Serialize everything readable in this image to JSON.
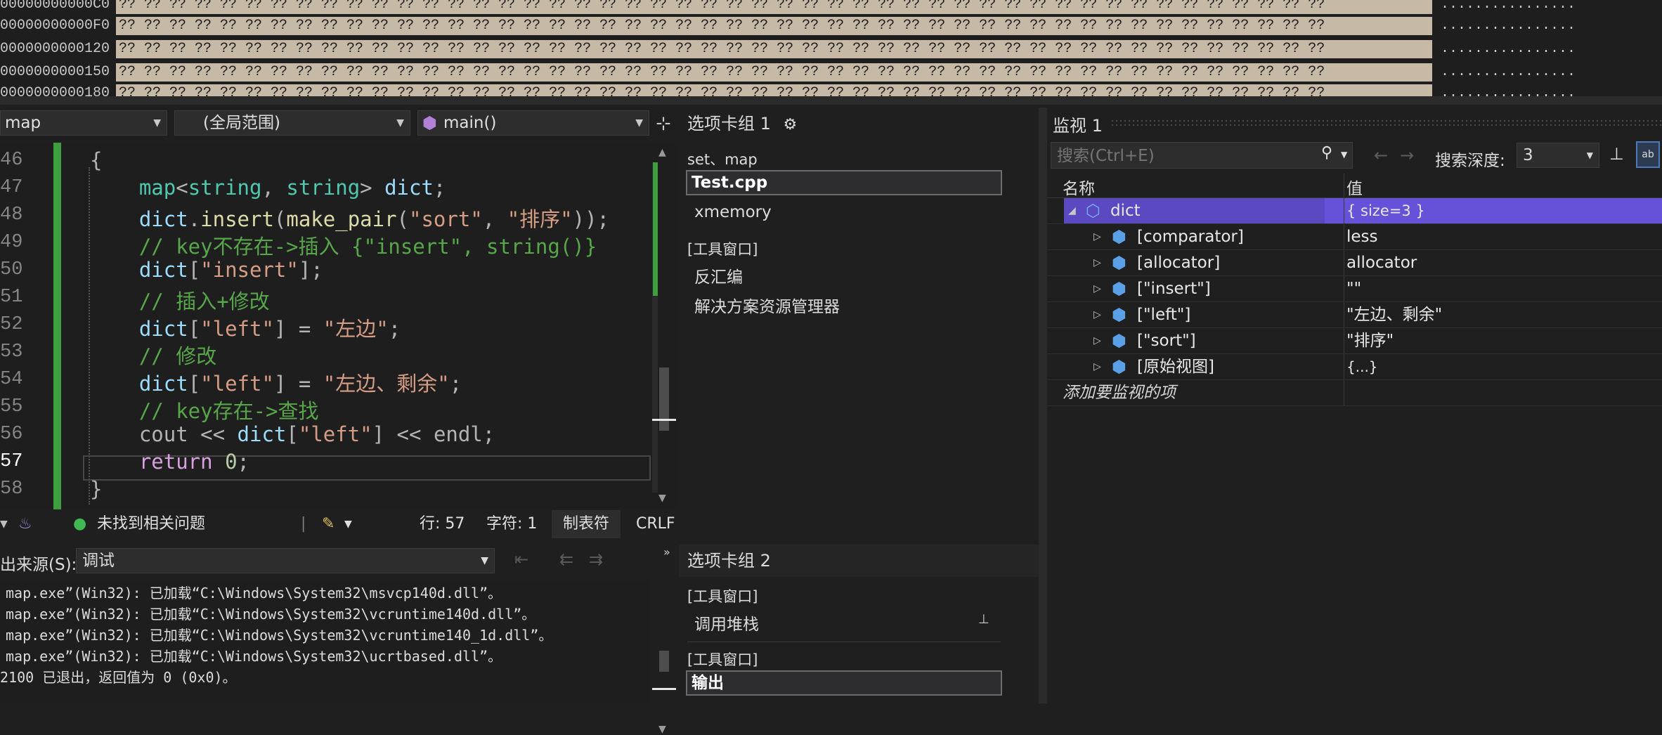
{
  "memory": {
    "rows": [
      {
        "address": "00000000000C0",
        "bytes": "?? ?? ?? ?? ?? ?? ?? ?? ?? ?? ?? ?? ?? ?? ?? ?? ?? ?? ?? ?? ?? ?? ?? ?? ?? ?? ?? ?? ?? ?? ?? ?? ?? ?? ?? ?? ?? ?? ?? ?? ?? ?? ?? ?? ?? ?? ?? ??",
        "chars": "................"
      },
      {
        "address": "00000000000F0",
        "bytes": "?? ?? ?? ?? ?? ?? ?? ?? ?? ?? ?? ?? ?? ?? ?? ?? ?? ?? ?? ?? ?? ?? ?? ?? ?? ?? ?? ?? ?? ?? ?? ?? ?? ?? ?? ?? ?? ?? ?? ?? ?? ?? ?? ?? ?? ?? ?? ??",
        "chars": "................"
      },
      {
        "address": "0000000000120",
        "bytes": "?? ?? ?? ?? ?? ?? ?? ?? ?? ?? ?? ?? ?? ?? ?? ?? ?? ?? ?? ?? ?? ?? ?? ?? ?? ?? ?? ?? ?? ?? ?? ?? ?? ?? ?? ?? ?? ?? ?? ?? ?? ?? ?? ?? ?? ?? ?? ??",
        "chars": "................"
      },
      {
        "address": "0000000000150",
        "bytes": "?? ?? ?? ?? ?? ?? ?? ?? ?? ?? ?? ?? ?? ?? ?? ?? ?? ?? ?? ?? ?? ?? ?? ?? ?? ?? ?? ?? ?? ?? ?? ?? ?? ?? ?? ?? ?? ?? ?? ?? ?? ?? ?? ?? ?? ?? ?? ??",
        "chars": "................"
      },
      {
        "address": "0000000000180",
        "bytes": "?? ?? ?? ?? ?? ?? ?? ?? ?? ?? ?? ?? ?? ?? ?? ?? ?? ?? ?? ?? ?? ?? ?? ?? ?? ?? ?? ?? ?? ?? ?? ?? ?? ?? ?? ?? ?? ?? ?? ?? ?? ?? ?? ?? ?? ?? ?? ??",
        "chars": "................"
      }
    ]
  },
  "navbar": {
    "project": "map",
    "scope": "(全局范围)",
    "function": "main()"
  },
  "editor": {
    "line_numbers": [
      "46",
      "47",
      "48",
      "49",
      "50",
      "51",
      "52",
      "53",
      "54",
      "55",
      "56",
      "57",
      "58"
    ],
    "lines": [
      [
        {
          "t": "{",
          "c": "op"
        }
      ],
      [
        {
          "t": "    "
        },
        {
          "t": "map",
          "c": "type"
        },
        {
          "t": "<",
          "c": "op"
        },
        {
          "t": "string",
          "c": "type"
        },
        {
          "t": ", ",
          "c": "op"
        },
        {
          "t": "string",
          "c": "type"
        },
        {
          "t": "> ",
          "c": "op"
        },
        {
          "t": "dict",
          "c": "id"
        },
        {
          "t": ";",
          "c": "op"
        }
      ],
      [
        {
          "t": "    "
        },
        {
          "t": "dict",
          "c": "id"
        },
        {
          "t": ".",
          "c": "op"
        },
        {
          "t": "insert",
          "c": "fn"
        },
        {
          "t": "(",
          "c": "op"
        },
        {
          "t": "make_pair",
          "c": "fn"
        },
        {
          "t": "(",
          "c": "op"
        },
        {
          "t": "\"sort\"",
          "c": "str"
        },
        {
          "t": ", ",
          "c": "op"
        },
        {
          "t": "\"排序\"",
          "c": "str"
        },
        {
          "t": "));",
          "c": "op"
        }
      ],
      [
        {
          "t": "    "
        },
        {
          "t": "// key不存在->插入 {\"insert\", string()}",
          "c": "cmt"
        }
      ],
      [
        {
          "t": "    "
        },
        {
          "t": "dict",
          "c": "id"
        },
        {
          "t": "[",
          "c": "op"
        },
        {
          "t": "\"insert\"",
          "c": "str"
        },
        {
          "t": "];",
          "c": "op"
        }
      ],
      [
        {
          "t": "    "
        },
        {
          "t": "// 插入+修改",
          "c": "cmt"
        }
      ],
      [
        {
          "t": "    "
        },
        {
          "t": "dict",
          "c": "id"
        },
        {
          "t": "[",
          "c": "op"
        },
        {
          "t": "\"left\"",
          "c": "str"
        },
        {
          "t": "] = ",
          "c": "op"
        },
        {
          "t": "\"左边\"",
          "c": "str"
        },
        {
          "t": ";",
          "c": "op"
        }
      ],
      [
        {
          "t": "    "
        },
        {
          "t": "// 修改",
          "c": "cmt"
        }
      ],
      [
        {
          "t": "    "
        },
        {
          "t": "dict",
          "c": "id"
        },
        {
          "t": "[",
          "c": "op"
        },
        {
          "t": "\"left\"",
          "c": "str"
        },
        {
          "t": "] = ",
          "c": "op"
        },
        {
          "t": "\"左边、剩余\"",
          "c": "str"
        },
        {
          "t": ";",
          "c": "op"
        }
      ],
      [
        {
          "t": "    "
        },
        {
          "t": "// key存在->查找",
          "c": "cmt"
        }
      ],
      [
        {
          "t": "    "
        },
        {
          "t": "cout ",
          "c": "op"
        },
        {
          "t": "<< ",
          "c": "op"
        },
        {
          "t": "dict",
          "c": "id"
        },
        {
          "t": "[",
          "c": "op"
        },
        {
          "t": "\"left\"",
          "c": "str"
        },
        {
          "t": "] << ",
          "c": "op"
        },
        {
          "t": "endl",
          "c": "op"
        },
        {
          "t": ";",
          "c": "op"
        }
      ],
      [
        {
          "t": "    "
        },
        {
          "t": "return ",
          "c": "ctl"
        },
        {
          "t": "0",
          "c": "num"
        },
        {
          "t": ";",
          "c": "op"
        }
      ],
      [
        {
          "t": "}",
          "c": "op"
        }
      ]
    ]
  },
  "statusbar": {
    "issues": "未找到相关问题",
    "line": "行: 57",
    "char": "字符: 1",
    "tabs": "制表符",
    "eol": "CRLF"
  },
  "output": {
    "source_label": "出来源(S):",
    "source_value": "调试",
    "lines": [
      "map.exe”(Win32): 已加载“C:\\Windows\\System32\\msvcp140d.dll”。",
      "map.exe”(Win32): 已加载“C:\\Windows\\System32\\vcruntime140d.dll”。",
      "map.exe”(Win32): 已加载“C:\\Windows\\System32\\vcruntime140_1d.dll”。",
      "map.exe”(Win32): 已加载“C:\\Windows\\System32\\ucrtbased.dll”。",
      "2100 已退出，返回值为 0 (0x0)。"
    ]
  },
  "tabgroup1": {
    "title": "选项卡组 1",
    "group_label": "set、map",
    "selected": "Test.cpp",
    "item2": "xmemory",
    "section": "[工具窗口]",
    "item3": "反汇编",
    "item4": "解决方案资源管理器"
  },
  "tabgroup2": {
    "title": "选项卡组 2",
    "section1": "[工具窗口]",
    "item1": "调用堆栈",
    "section2": "[工具窗口]",
    "selected": "输出"
  },
  "watch": {
    "title": "监视 1",
    "search_placeholder": "搜索(Ctrl+E)",
    "depth_label": "搜索深度:",
    "depth_value": "3",
    "col_name": "名称",
    "col_value": "值",
    "rows": [
      {
        "name": "dict",
        "value": "{ size=3 }"
      },
      {
        "name": "[comparator]",
        "value": "less"
      },
      {
        "name": "[allocator]",
        "value": "allocator"
      },
      {
        "name": "[\"insert\"]",
        "value": "\"\""
      },
      {
        "name": "[\"left\"]",
        "value": "\"左边、剩余\""
      },
      {
        "name": "[\"sort\"]",
        "value": "\"排序\""
      },
      {
        "name": "[原始视图]",
        "value": "{...}"
      }
    ],
    "add_item": "添加要监视的项"
  },
  "colors": {
    "accent": "#7160e8",
    "change_bar": "#3f9e3f",
    "ok": "#3fb950"
  }
}
